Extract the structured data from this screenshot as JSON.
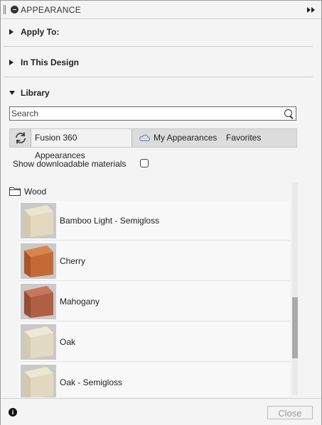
{
  "header": {
    "title": "APPEARANCE",
    "collapse_icon": "minus-circle-icon",
    "expand_icon": "double-chevron-right-icon"
  },
  "sections": {
    "apply_to": {
      "label": "Apply To:",
      "expanded": false
    },
    "in_this_design": {
      "label": "In This Design",
      "expanded": false
    },
    "library": {
      "label": "Library",
      "expanded": true
    }
  },
  "search": {
    "placeholder": "Search",
    "value": ""
  },
  "library_tabs": {
    "refresh_icon": "refresh-icon",
    "tabs": [
      {
        "label": "Fusion 360 Appearances",
        "active": true
      },
      {
        "label": "My Appearances",
        "active": false,
        "icon": "cloud-icon"
      },
      {
        "label": "Favorites",
        "active": false
      }
    ]
  },
  "options": {
    "show_downloadable_label": "Show downloadable materials",
    "show_downloadable_checked": false
  },
  "folder": {
    "label": "Wood",
    "icon": "folder-icon"
  },
  "materials": [
    {
      "name": "Bamboo Light - Semigloss",
      "colors": [
        "#ece4cf",
        "#e3d9c0",
        "#d4c9ad"
      ]
    },
    {
      "name": "Cherry",
      "colors": [
        "#d9844e",
        "#c36a36",
        "#a9552a"
      ]
    },
    {
      "name": "Mahogany",
      "colors": [
        "#c8755a",
        "#b05f44",
        "#964c35"
      ]
    },
    {
      "name": "Oak",
      "colors": [
        "#eee8d6",
        "#e2dac3",
        "#d3caaf"
      ]
    },
    {
      "name": "Oak - Semigloss",
      "colors": [
        "#ede6d1",
        "#e1d8bf",
        "#d2c8ab"
      ]
    }
  ],
  "footer": {
    "info_icon": "info-icon",
    "close_label": "Close",
    "close_enabled": false
  }
}
